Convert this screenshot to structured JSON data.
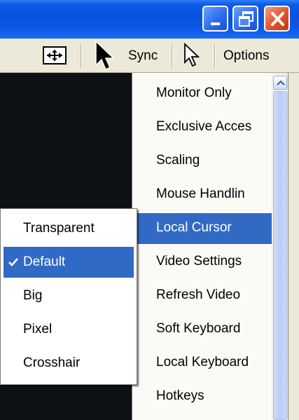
{
  "window": {
    "controls": [
      "minimize-icon",
      "restore-icon",
      "close-icon"
    ],
    "titlebar_color": "#0a58e6",
    "close_color": "#e0542c"
  },
  "toolbar": {
    "fit_icon": "fit-window-icon",
    "sync_icon": "cursor-arrow-icon",
    "sync_label": "Sync",
    "cursor_icon": "outline-cursor-icon",
    "options_label": "Options"
  },
  "menu": {
    "items": [
      {
        "label": "Monitor Only",
        "active": false
      },
      {
        "label": "Exclusive Acces",
        "active": false
      },
      {
        "label": "Scaling",
        "active": false
      },
      {
        "label": "Mouse Handlin",
        "active": false
      },
      {
        "label": "Local Cursor",
        "active": true
      },
      {
        "label": "Video Settings",
        "active": false
      },
      {
        "label": "Refresh Video",
        "active": false
      },
      {
        "label": "Soft Keyboard",
        "active": false
      },
      {
        "label": "Local Keyboard",
        "active": false
      },
      {
        "label": "Hotkeys",
        "active": false
      }
    ],
    "highlight_color": "#316ac5"
  },
  "submenu": {
    "items": [
      {
        "label": "Transparent",
        "checked": false,
        "active": false
      },
      {
        "label": "Default",
        "checked": true,
        "active": true
      },
      {
        "label": "Big",
        "checked": false,
        "active": false
      },
      {
        "label": "Pixel",
        "checked": false,
        "active": false
      },
      {
        "label": "Crosshair",
        "checked": false,
        "active": false
      }
    ]
  }
}
